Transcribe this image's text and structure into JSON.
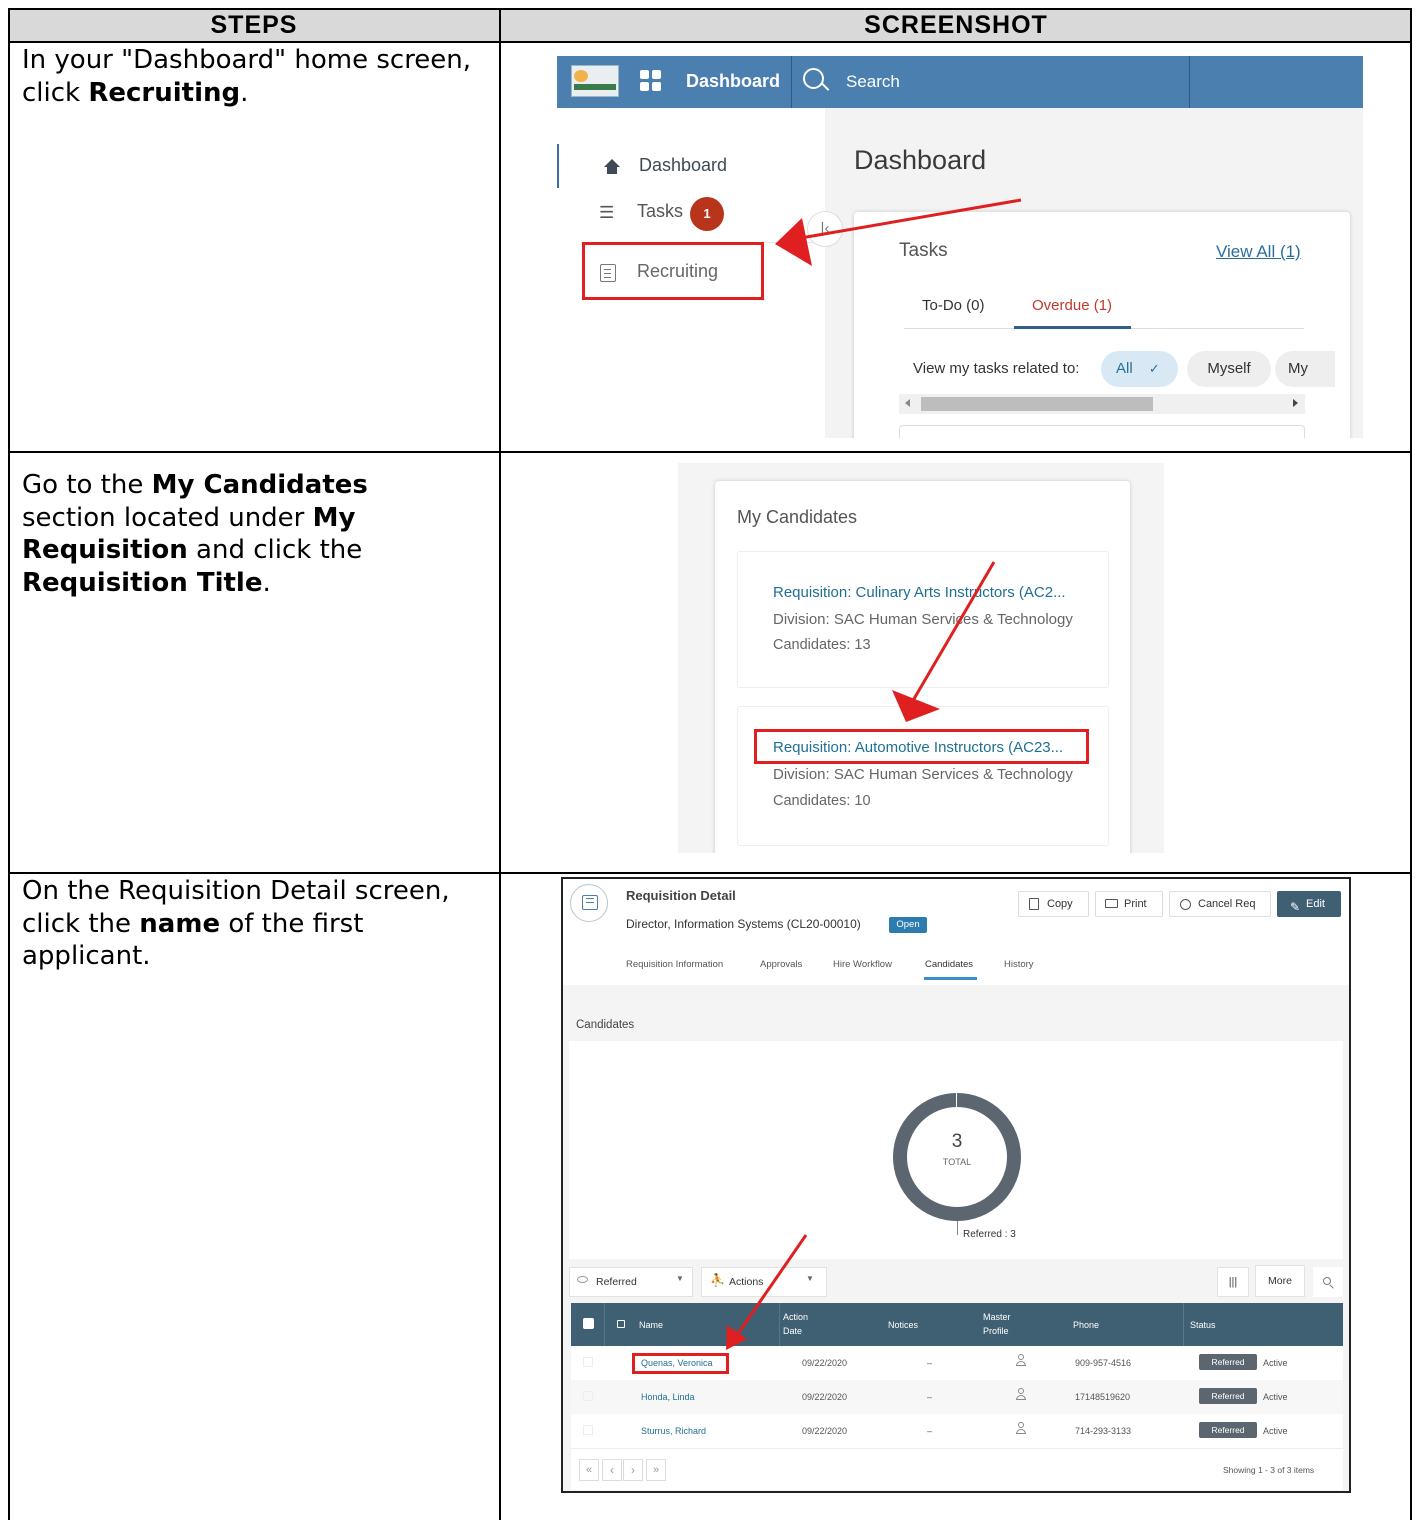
{
  "table": {
    "headers": {
      "steps": "STEPS",
      "screenshot": "SCREENSHOT"
    },
    "steps": [
      {
        "parts": [
          "In your \"Dashboard\" home screen, click ",
          "Recruiting",
          "."
        ]
      },
      {
        "parts": [
          "Go to the ",
          "My Candidates",
          " section located under ",
          "My Requisition",
          " and click the ",
          "Requisition Title",
          "."
        ]
      },
      {
        "parts": [
          "On the Requisition Detail screen, click the ",
          "name",
          " of the first applicant."
        ]
      }
    ]
  },
  "shot1": {
    "topbar": {
      "dashboard": "Dashboard",
      "search": "Search"
    },
    "sidebar": {
      "dashboard": "Dashboard",
      "tasks": "Tasks",
      "tasks_badge": "1",
      "recruiting": "Recruiting"
    },
    "page_title": "Dashboard",
    "tasks_card": {
      "title": "Tasks",
      "view_all": "View All (1)",
      "tabs": [
        "To-Do (0)",
        "Overdue (1)"
      ],
      "filter_label": "View my tasks related to:",
      "chips": [
        "All",
        "Myself",
        "My"
      ]
    }
  },
  "shot2": {
    "title": "My Candidates",
    "items": [
      {
        "req": "Requisition: Culinary Arts Instructors (AC2...",
        "division": "Division: SAC Human Services & Technology",
        "candidates": "Candidates: 13"
      },
      {
        "req": "Requisition: Automotive Instructors (AC23...",
        "division": "Division: SAC Human Services & Technology",
        "candidates": "Candidates: 10"
      }
    ]
  },
  "shot3": {
    "title": "Requisition Detail",
    "subtitle": "Director, Information Systems (CL20-00010)",
    "status": "Open",
    "buttons": {
      "copy": "Copy",
      "print": "Print",
      "cancel": "Cancel Req",
      "edit": "Edit"
    },
    "tabs": [
      "Requisition Information",
      "Approvals",
      "Hire Workflow",
      "Candidates",
      "History"
    ],
    "section": "Candidates",
    "donut": {
      "total": "3",
      "total_label": "TOTAL",
      "legend": "Referred : 3"
    },
    "toolbar": {
      "filter": "Referred",
      "actions": "Actions",
      "more": "More"
    },
    "columns": [
      "Name",
      "Action Date",
      "Notices",
      "Master Profile",
      "Phone",
      "Status"
    ],
    "rows": [
      {
        "name": "Quenas, Veronica",
        "date": "09/22/2020",
        "notices": "–",
        "phone": "909-957-4516",
        "badge": "Referred",
        "status": "Active"
      },
      {
        "name": "Honda, Linda",
        "date": "09/22/2020",
        "notices": "–",
        "phone": "17148519620",
        "badge": "Referred",
        "status": "Active"
      },
      {
        "name": "Sturrus, Richard",
        "date": "09/22/2020",
        "notices": "–",
        "phone": "714-293-3133",
        "badge": "Referred",
        "status": "Active"
      }
    ],
    "pager": {
      "first": "«",
      "prev": "‹",
      "next": "›",
      "last": "»",
      "showing": "Showing 1 - 3 of 3 items"
    }
  },
  "colors": {
    "topbar": "#4a7fb0",
    "annotation_red": "#e02020",
    "table_header": "#3f5f73",
    "link": "#1f6f93",
    "overdue": "#c0392b"
  }
}
